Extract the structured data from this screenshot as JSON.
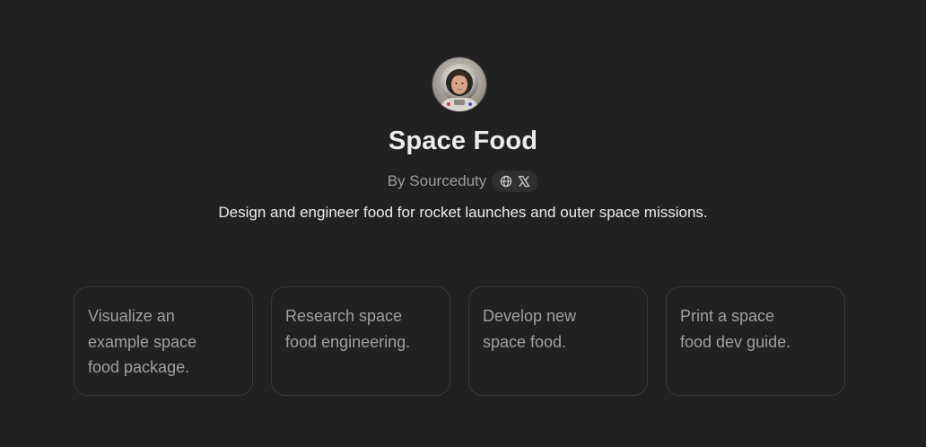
{
  "gpt": {
    "title": "Space Food",
    "byline": "By Sourceduty",
    "description": "Design and engineer food for rocket launches and outer space missions."
  },
  "social": {
    "website_icon": "globe-icon",
    "x_icon": "x-logo-icon"
  },
  "starters": [
    {
      "lines": [
        "Visualize an",
        "example space",
        "food package."
      ]
    },
    {
      "lines": [
        "Research space",
        "food engineering."
      ]
    },
    {
      "lines": [
        "Develop new",
        "space food."
      ]
    },
    {
      "lines": [
        "Print a space",
        "food dev guide."
      ]
    }
  ],
  "colors": {
    "background": "#212121",
    "card_border": "#3a3a3a",
    "muted_text": "#9b9b9b",
    "pill_background": "#2f2f2f"
  }
}
